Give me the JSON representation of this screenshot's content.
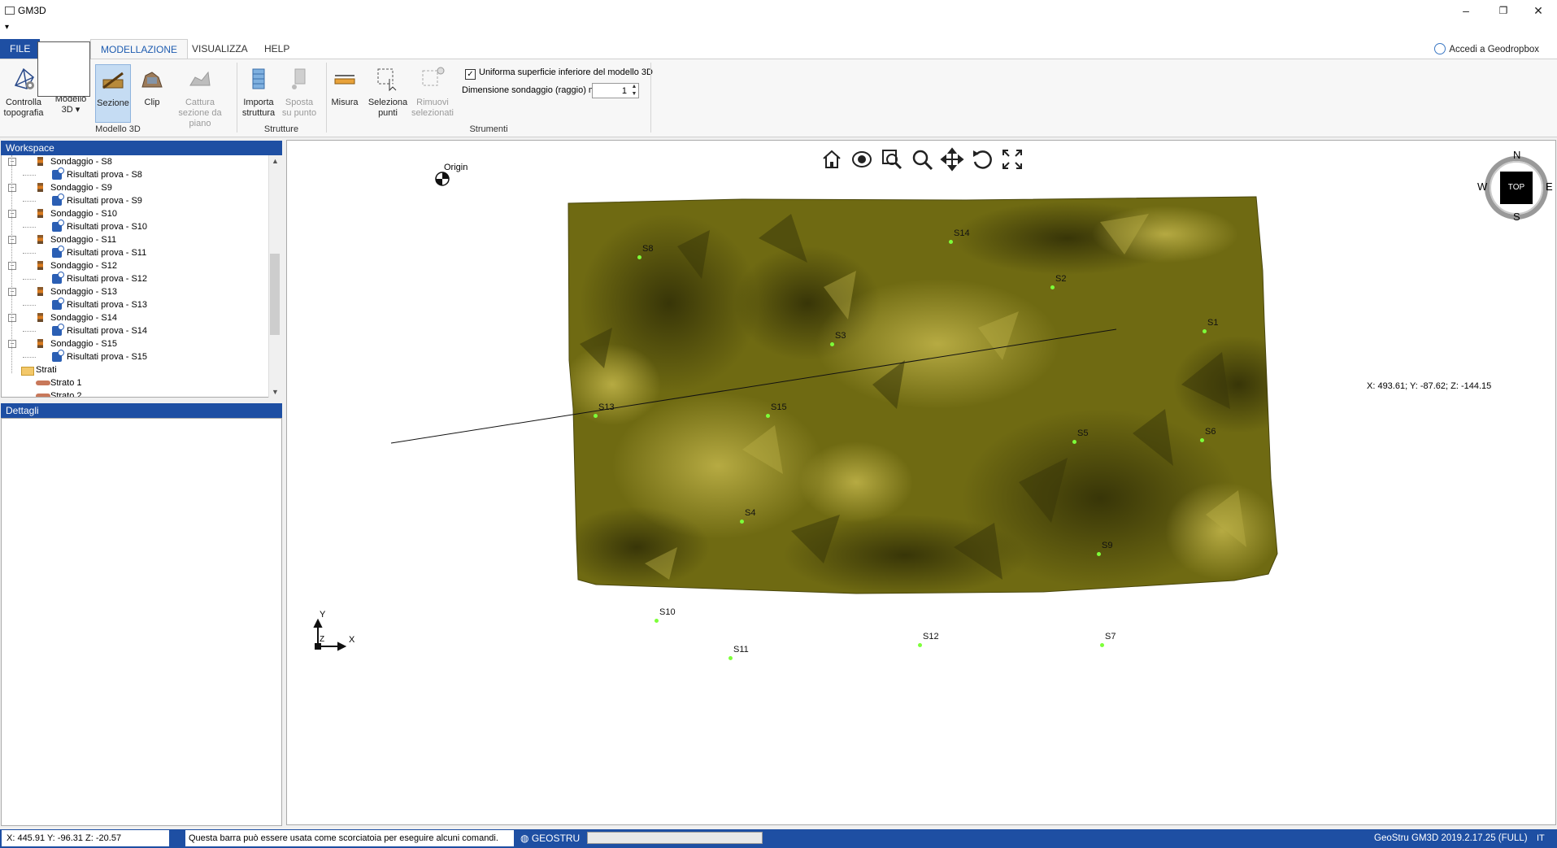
{
  "window": {
    "title": "GM3D",
    "minimize": "–",
    "maximize": "❐",
    "close": "✕"
  },
  "qat": {
    "arrow": "▾"
  },
  "tabs": [
    {
      "label": "FILE"
    },
    {
      "label": "MODELLAZIONE"
    },
    {
      "label": "VISUALIZZA"
    },
    {
      "label": "HELP"
    }
  ],
  "dropbox": {
    "label": "Accedi a Geodropbox"
  },
  "ribbon": {
    "modello3d": {
      "group_label": "Modello 3D",
      "controlla": "Controlla topografia",
      "modello": "Modello 3D ▾",
      "sezione": "Sezione",
      "clip": "Clip",
      "cattura": "Cattura sezione da piano"
    },
    "strutture": {
      "group_label": "Strutture",
      "importa": "Importa struttura",
      "sposta": "Sposta su punto"
    },
    "strumenti": {
      "group_label": "Strumenti",
      "misura": "Misura",
      "seleziona": "Seleziona punti",
      "rimuovi": "Rimuovi selezionati",
      "uniforma_label": "Uniforma superficie inferiore del modello 3D",
      "uniforma_checked": true,
      "dimensione_label": "Dimensione sondaggio (raggio) m",
      "dimensione_value": "1"
    }
  },
  "workspace": {
    "title": "Workspace",
    "nodes": [
      {
        "kind": "sondaggio",
        "label": "Sondaggio - S8"
      },
      {
        "kind": "risultati",
        "label": "Risultati prova - S8"
      },
      {
        "kind": "sondaggio",
        "label": "Sondaggio - S9"
      },
      {
        "kind": "risultati",
        "label": "Risultati prova - S9"
      },
      {
        "kind": "sondaggio",
        "label": "Sondaggio - S10"
      },
      {
        "kind": "risultati",
        "label": "Risultati prova - S10"
      },
      {
        "kind": "sondaggio",
        "label": "Sondaggio - S11"
      },
      {
        "kind": "risultati",
        "label": "Risultati prova - S11"
      },
      {
        "kind": "sondaggio",
        "label": "Sondaggio - S12"
      },
      {
        "kind": "risultati",
        "label": "Risultati prova - S12"
      },
      {
        "kind": "sondaggio",
        "label": "Sondaggio - S13"
      },
      {
        "kind": "risultati",
        "label": "Risultati prova - S13"
      },
      {
        "kind": "sondaggio",
        "label": "Sondaggio - S14"
      },
      {
        "kind": "risultati",
        "label": "Risultati prova - S14"
      },
      {
        "kind": "sondaggio",
        "label": "Sondaggio - S15"
      },
      {
        "kind": "risultati",
        "label": "Risultati prova - S15"
      },
      {
        "kind": "folder",
        "label": "Strati"
      },
      {
        "kind": "strato",
        "label": "Strato 1"
      },
      {
        "kind": "strato",
        "label": "Strato 2"
      }
    ]
  },
  "details": {
    "title": "Dettagli"
  },
  "viewport": {
    "origin_label": "Origin",
    "compass": {
      "n": "N",
      "s": "S",
      "e": "E",
      "w": "W",
      "center": "TOP"
    },
    "axis": {
      "x": "X",
      "y": "Y",
      "z": "Z"
    },
    "coord_readout": "X: 493.61; Y: -87.62; Z: -144.15",
    "surface_color": "#6f6a12",
    "boreholes": [
      "S8",
      "S14",
      "S2",
      "S1",
      "S3",
      "S13",
      "S15",
      "S5",
      "S6",
      "S4",
      "S9",
      "S10",
      "S12",
      "S7",
      "S11"
    ]
  },
  "status": {
    "coords": "X: 445.91   Y: -96.31   Z: -20.57",
    "command_hint": "Questa barra può essere usata come scorciatoia per eseguire alcuni comandi.",
    "geostru": "GEOSTRU",
    "version": "GeoStru GM3D 2019.2.17.25 (FULL)",
    "lang": "IT"
  },
  "colors": {
    "accent": "#1e4fa3",
    "surface": "#6f6a12"
  }
}
